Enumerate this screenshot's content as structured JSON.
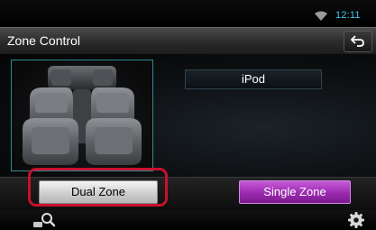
{
  "status": {
    "time": "12:11",
    "wifi_icon": "wifi-icon"
  },
  "header": {
    "title": "Zone Control",
    "back_icon": "back-arrow-icon"
  },
  "main": {
    "seat_image": "car-seats-illustration",
    "source_label": "iPod"
  },
  "buttons": {
    "dual_zone": "Dual Zone",
    "single_zone": "Single Zone",
    "dual_zone_highlight_color": "#c8102e",
    "single_zone_color": "#9b2aae"
  },
  "bottom": {
    "search_icon": "search-icon",
    "settings_icon": "gear-icon"
  },
  "colors": {
    "time_text": "#42c8f0",
    "panel_border": "#2e8a92"
  }
}
